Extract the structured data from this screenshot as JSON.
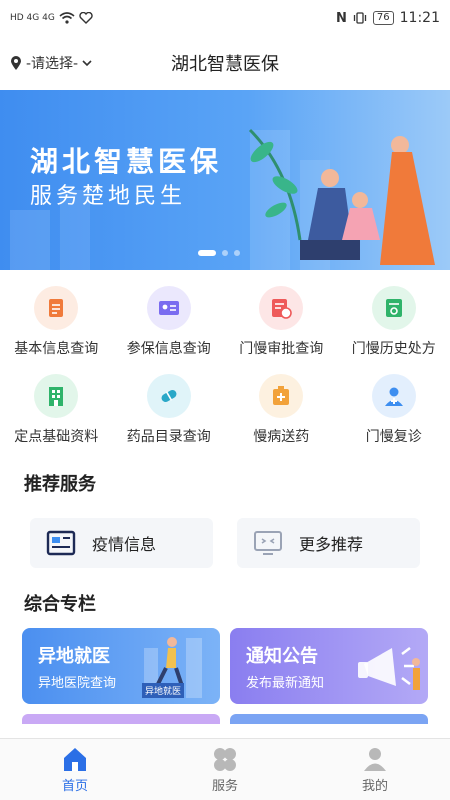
{
  "status_bar": {
    "left_text": "HD 4G 4G",
    "battery": "76",
    "time": "11:21"
  },
  "header": {
    "location": "-请选择-",
    "title": "湖北智慧医保"
  },
  "banner": {
    "line1": "湖北智慧医保",
    "line2": "服务楚地民生"
  },
  "services": [
    {
      "label": "基本信息查询",
      "icon": "document-icon",
      "color": "#f07a3a",
      "bg": "#fdece2"
    },
    {
      "label": "参保信息查询",
      "icon": "id-card-icon",
      "color": "#7a6cf0",
      "bg": "#ebe8fd"
    },
    {
      "label": "门慢审批查询",
      "icon": "approval-icon",
      "color": "#ee5a5a",
      "bg": "#fde6e6"
    },
    {
      "label": "门慢历史处方",
      "icon": "prescription-icon",
      "color": "#2fb36a",
      "bg": "#e2f6ea"
    },
    {
      "label": "定点基础资料",
      "icon": "building-icon",
      "color": "#2fb36a",
      "bg": "#e2f6ea"
    },
    {
      "label": "药品目录查询",
      "icon": "pill-icon",
      "color": "#2aa8c8",
      "bg": "#e0f4f9"
    },
    {
      "label": "慢病送药",
      "icon": "medicine-box-icon",
      "color": "#f2a23a",
      "bg": "#fdf1e0"
    },
    {
      "label": "门慢复诊",
      "icon": "doctor-icon",
      "color": "#3d8ef0",
      "bg": "#e3effd"
    }
  ],
  "recommend": {
    "title": "推荐服务",
    "items": [
      {
        "label": "疫情信息",
        "icon": "news-icon"
      },
      {
        "label": "更多推荐",
        "icon": "monitor-icon"
      }
    ]
  },
  "columns": {
    "title": "综合专栏",
    "items": [
      {
        "title": "异地就医",
        "subtitle": "异地医院查询",
        "tag": "异地就医"
      },
      {
        "title": "通知公告",
        "subtitle": "发布最新通知"
      }
    ]
  },
  "tabbar": [
    {
      "label": "首页",
      "icon": "home-icon"
    },
    {
      "label": "服务",
      "icon": "grid-icon"
    },
    {
      "label": "我的",
      "icon": "user-icon"
    }
  ]
}
